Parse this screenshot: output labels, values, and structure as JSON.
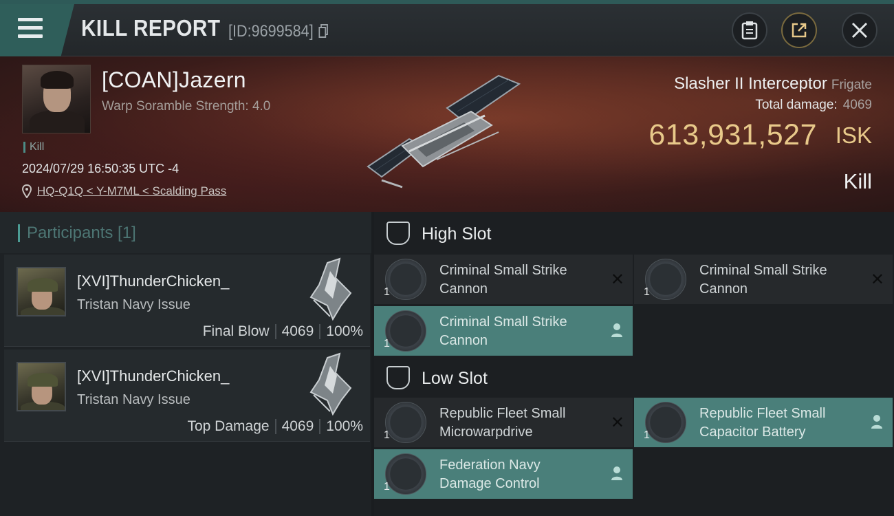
{
  "header": {
    "title": "KILL REPORT",
    "report_id": "[ID:9699584]"
  },
  "victim": {
    "name": "[COAN]Jazern",
    "subtitle": "Warp Soramble Strength: 4.0",
    "tag": "Kill",
    "timestamp": "2024/07/29 16:50:35 UTC -4",
    "location": "HQ-Q1Q < Y-M7ML < Scalding Pass"
  },
  "ship": {
    "name": "Slasher II Interceptor",
    "class": "Frigate",
    "total_damage_label": "Total damage:",
    "total_damage": "4069",
    "isk_value": "613,931,527",
    "isk_unit": "ISK",
    "result": "Kill"
  },
  "participants": {
    "title": "Participants [1]",
    "items": [
      {
        "name": "[XVI]ThunderChicken_",
        "ship": "Tristan Navy Issue",
        "role": "Final Blow",
        "damage": "4069",
        "percent": "100%"
      },
      {
        "name": "[XVI]ThunderChicken_",
        "ship": "Tristan Navy Issue",
        "role": "Top Damage",
        "damage": "4069",
        "percent": "100%"
      }
    ]
  },
  "slots": {
    "high": {
      "label": "High Slot",
      "modules": [
        {
          "name_line1": "Criminal Small Strike",
          "name_line2": "Cannon",
          "qty": "1",
          "status": "destroyed"
        },
        {
          "name_line1": "Criminal Small Strike",
          "name_line2": "Cannon",
          "qty": "1",
          "status": "destroyed"
        },
        {
          "name_line1": "Criminal Small Strike",
          "name_line2": "Cannon",
          "qty": "1",
          "status": "dropped"
        }
      ]
    },
    "low": {
      "label": "Low Slot",
      "modules": [
        {
          "name_line1": "Republic Fleet Small",
          "name_line2": "Microwarpdrive",
          "qty": "1",
          "status": "destroyed"
        },
        {
          "name_line1": "Republic Fleet Small",
          "name_line2": "Capacitor Battery",
          "qty": "1",
          "status": "dropped"
        },
        {
          "name_line1": "Federation Navy",
          "name_line2": "Damage Control",
          "qty": "1",
          "status": "dropped"
        }
      ]
    }
  },
  "colors": {
    "accent": "#2f5e5a",
    "active_module": "#4a7f7a",
    "isk_gold": "#e8c98a"
  },
  "icons": {
    "menu": "hamburger-icon",
    "copy": "copy-icon",
    "clipboard": "clipboard-icon",
    "share": "share-icon",
    "close": "close-icon",
    "location": "map-pin-icon",
    "slot": "shield-slot-icon",
    "destroyed": "x-mark-icon",
    "dropped": "person-icon"
  }
}
